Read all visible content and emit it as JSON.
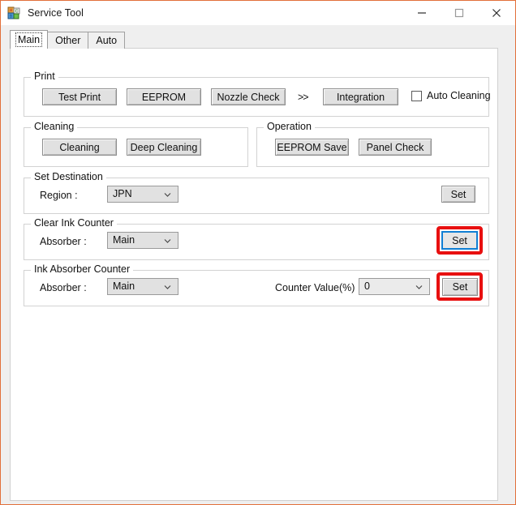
{
  "window": {
    "title": "Service Tool",
    "icon": "app-blocks-icon",
    "accent_border": "#e2703a",
    "controls": [
      {
        "name": "minimize",
        "glyph": "minimize-icon"
      },
      {
        "name": "maximize",
        "glyph": "maximize-icon"
      },
      {
        "name": "close",
        "glyph": "close-icon"
      }
    ]
  },
  "tabs": [
    {
      "label": "Main",
      "selected": true
    },
    {
      "label": "Other",
      "selected": false
    },
    {
      "label": "Auto",
      "selected": false
    }
  ],
  "groups": {
    "print": {
      "legend": "Print",
      "buttons": [
        {
          "label": "Test Print"
        },
        {
          "label": "EEPROM"
        },
        {
          "label": "Nozzle Check"
        },
        {
          "label": "Integration"
        }
      ],
      "separator": ">>",
      "checkbox": {
        "label": "Auto Cleaning",
        "checked": false
      }
    },
    "cleaning": {
      "legend": "Cleaning",
      "buttons": [
        {
          "label": "Cleaning"
        },
        {
          "label": "Deep Cleaning"
        }
      ]
    },
    "operation": {
      "legend": "Operation",
      "buttons": [
        {
          "label": "EEPROM Save"
        },
        {
          "label": "Panel Check"
        }
      ]
    },
    "set_destination": {
      "legend": "Set Destination",
      "region_label": "Region :",
      "region_value": "JPN",
      "set_label": "Set"
    },
    "clear_ink_counter": {
      "legend": "Clear Ink Counter",
      "absorber_label": "Absorber :",
      "absorber_value": "Main",
      "set_label": "Set",
      "highlight_color": "#e81010",
      "focus_color": "#0f7fd4"
    },
    "ink_absorber_counter": {
      "legend": "Ink Absorber Counter",
      "absorber_label": "Absorber :",
      "absorber_value": "Main",
      "counter_label": "Counter Value(%) :",
      "counter_value": "0",
      "set_label": "Set",
      "highlight_color": "#e81010"
    }
  }
}
